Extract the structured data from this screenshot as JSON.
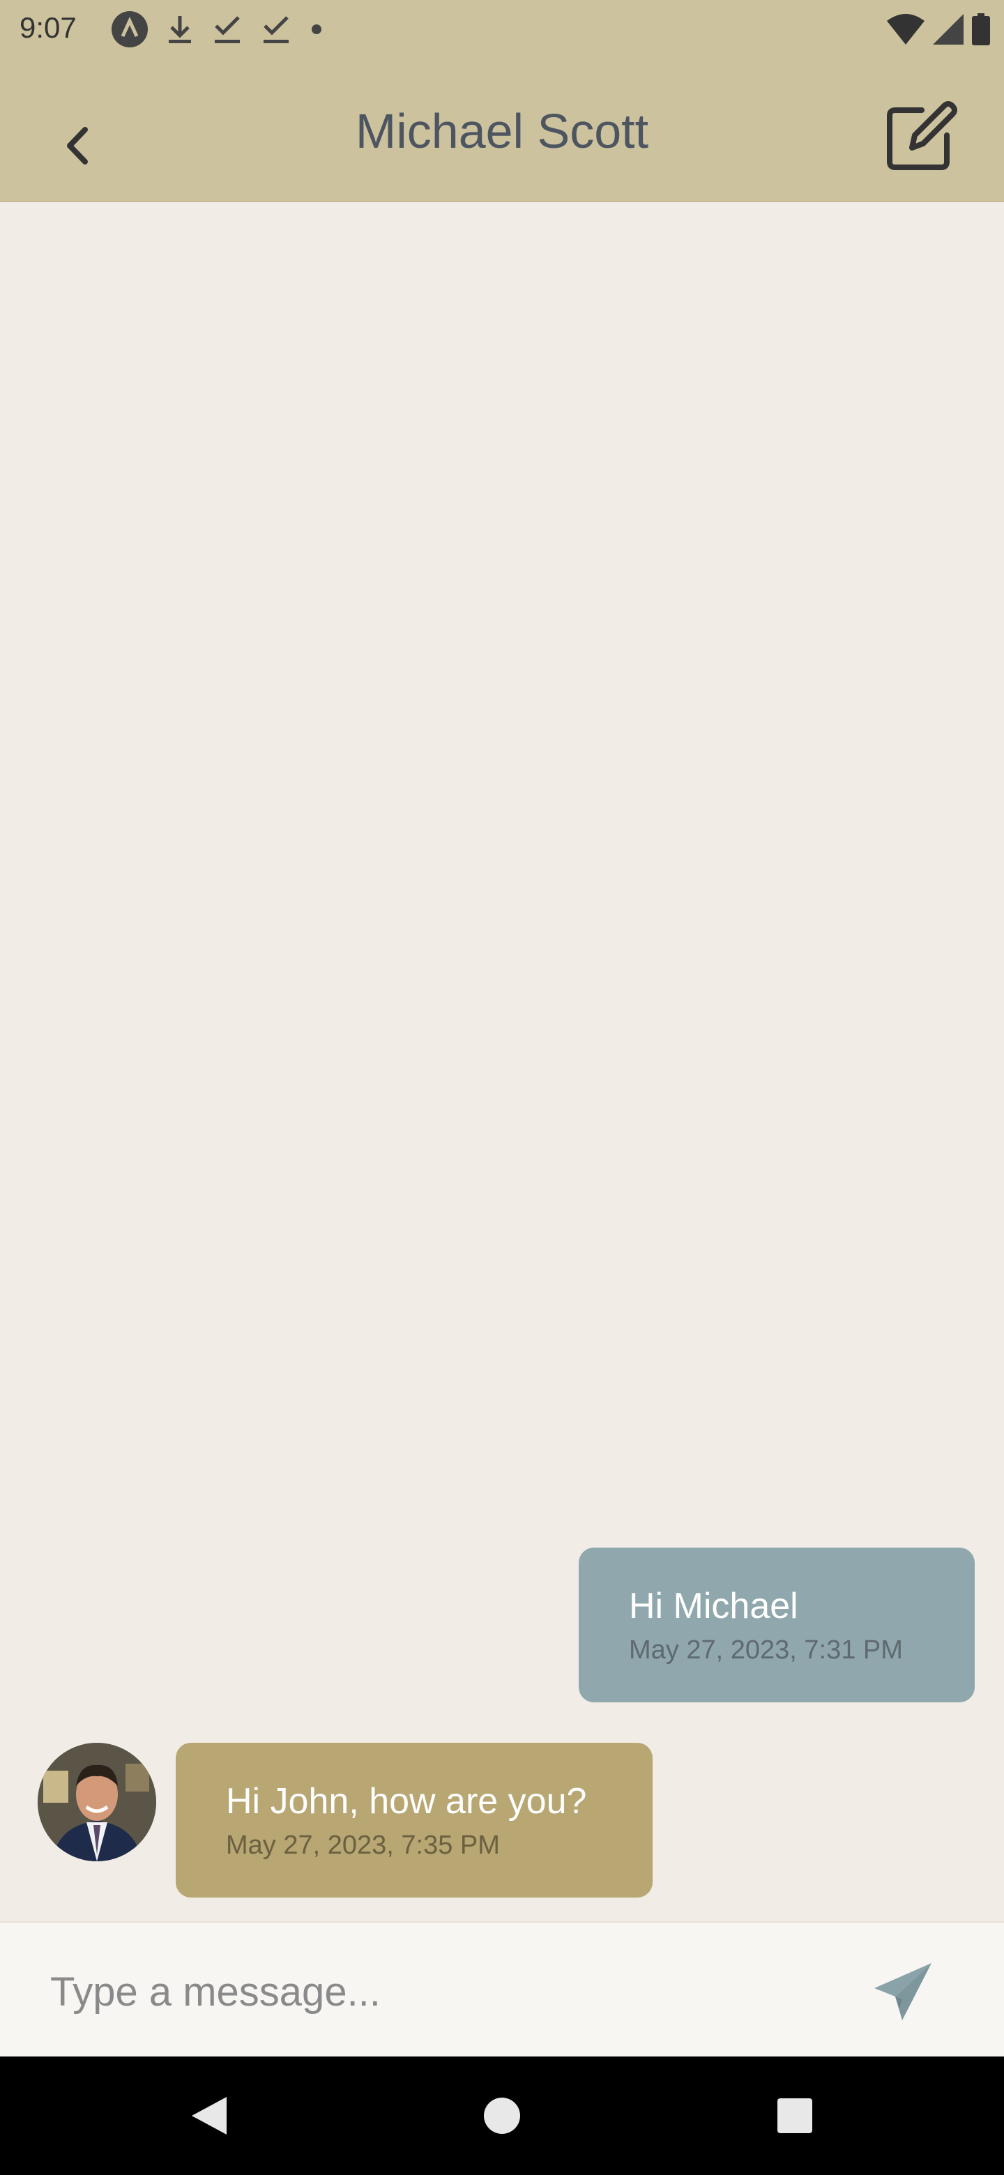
{
  "status": {
    "time": "9:07",
    "icons": [
      "app-icon",
      "download-icon",
      "check-icon",
      "check-icon",
      "dot-icon",
      "wifi-icon",
      "signal-icon",
      "battery-icon"
    ]
  },
  "header": {
    "title": "Michael Scott",
    "back_icon": "chevron-left-icon",
    "edit_icon": "edit-icon"
  },
  "messages": [
    {
      "direction": "outgoing",
      "text": "Hi Michael",
      "time": "May 27, 2023, 7:31 PM"
    },
    {
      "direction": "incoming",
      "text": "Hi John, how are you?",
      "time": "May 27, 2023, 7:35 PM",
      "avatar": "michael-avatar"
    }
  ],
  "composer": {
    "placeholder": "Type a message...",
    "send_icon": "send-icon"
  },
  "colors": {
    "header_bg": "#cdc29e",
    "chat_bg": "#f1ece6",
    "outgoing_bubble": "#90a8ad",
    "incoming_bubble": "#b8a673",
    "title_text": "#4d5560"
  }
}
